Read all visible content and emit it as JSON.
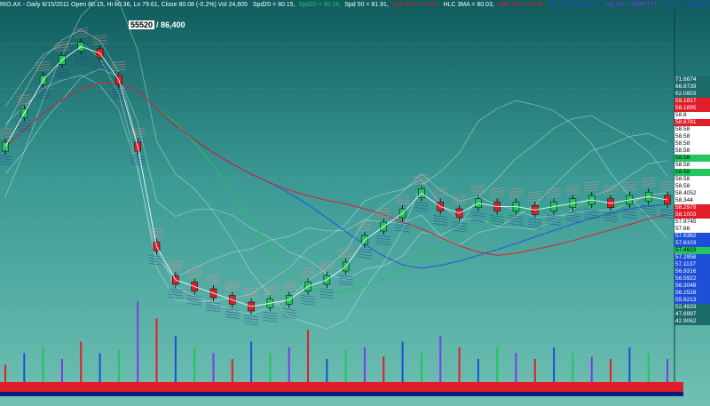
{
  "header": {
    "symbol": "RIO.AX - Daily 6/15/2011 Open 80.15, Hi 80.36, Lo 79.61, Close 80.08 (-0.2%) Vol 24,605",
    "indicators": [
      {
        "text": "Spd20 = 80.15,",
        "color": "#ffffff"
      },
      {
        "text": "Spd10 = 80.16,",
        "color": "#22c55e"
      },
      {
        "text": "Spd 50 = 81.91,",
        "color": "#ffffff"
      },
      {
        "text": "Spd 200 = 82.52,",
        "color": "#e11d2a"
      },
      {
        "text": "HLC 3MA = 80.03,",
        "color": "#ffffff"
      },
      {
        "text": "Spd 100 = 79.88,",
        "color": "#e11d2a"
      },
      {
        "text": "Dly R1 = {EMPTY},",
        "color": "#1d4ed8"
      },
      {
        "text": "Dly R2 = {EMPTY},",
        "color": "#7c3aed"
      },
      {
        "text": "Dly S1 = {EMPTY},",
        "color": "#1d4ed8"
      },
      {
        "text": "Daily Open = {EMPTY},",
        "color": "#111827"
      },
      {
        "text": "Daily Vol",
        "color": "#16a34a"
      }
    ]
  },
  "cursor": {
    "bar": "55520",
    "value": "/ 86,400"
  },
  "price_labels": [
    {
      "text": "71.6674",
      "bg": "#1b6b6a",
      "fg": "#ffffff"
    },
    {
      "text": "66.8739",
      "bg": "#1b6b6a",
      "fg": "#ffffff"
    },
    {
      "text": "62.0803",
      "bg": "#1b6b6a",
      "fg": "#ffffff"
    },
    {
      "text": "59.1817",
      "bg": "#e11d2a",
      "fg": "#ffffff"
    },
    {
      "text": "58.1895",
      "bg": "#e11d2a",
      "fg": "#ffffff"
    },
    {
      "text": "58.8",
      "bg": "#ffffff",
      "fg": "#000000"
    },
    {
      "text": "58.6781",
      "bg": "#e11d2a",
      "fg": "#ffffff"
    },
    {
      "text": "58.58",
      "bg": "#ffffff",
      "fg": "#000000"
    },
    {
      "text": "58.58",
      "bg": "#ffffff",
      "fg": "#000000"
    },
    {
      "text": "58.58",
      "bg": "#ffffff",
      "fg": "#000000"
    },
    {
      "text": "58.58",
      "bg": "#ffffff",
      "fg": "#000000"
    },
    {
      "text": "58.58",
      "bg": "#22c55e",
      "fg": "#000000"
    },
    {
      "text": "58.58",
      "bg": "#ffffff",
      "fg": "#000000"
    },
    {
      "text": "58.58",
      "bg": "#22c55e",
      "fg": "#000000"
    },
    {
      "text": "58.58",
      "bg": "#ffffff",
      "fg": "#000000"
    },
    {
      "text": "58.58",
      "bg": "#ffffff",
      "fg": "#000000"
    },
    {
      "text": "58.4052",
      "bg": "#ffffff",
      "fg": "#000000"
    },
    {
      "text": "58.344",
      "bg": "#ffffff",
      "fg": "#000000"
    },
    {
      "text": "58.2979",
      "bg": "#e11d2a",
      "fg": "#ffffff"
    },
    {
      "text": "58.1003",
      "bg": "#e11d2a",
      "fg": "#ffffff"
    },
    {
      "text": "57.9745",
      "bg": "#ffffff",
      "fg": "#000000"
    },
    {
      "text": "57.66",
      "bg": "#ffffff",
      "fg": "#000000"
    },
    {
      "text": "57.6362",
      "bg": "#1d4ed8",
      "fg": "#ffffff"
    },
    {
      "text": "57.6103",
      "bg": "#1d4ed8",
      "fg": "#ffffff"
    },
    {
      "text": "57.4623",
      "bg": "#22c55e",
      "fg": "#000000"
    },
    {
      "text": "57.2958",
      "bg": "#1d4ed8",
      "fg": "#ffffff"
    },
    {
      "text": "57.1137",
      "bg": "#1d4ed8",
      "fg": "#ffffff"
    },
    {
      "text": "56.9316",
      "bg": "#1d4ed8",
      "fg": "#ffffff"
    },
    {
      "text": "56.5922",
      "bg": "#1d4ed8",
      "fg": "#ffffff"
    },
    {
      "text": "56.3048",
      "bg": "#1d4ed8",
      "fg": "#ffffff"
    },
    {
      "text": "56.2528",
      "bg": "#1d4ed8",
      "fg": "#ffffff"
    },
    {
      "text": "55.6213",
      "bg": "#1d4ed8",
      "fg": "#ffffff"
    },
    {
      "text": "52.4933",
      "bg": "#1b6b6a",
      "fg": "#ffffff"
    },
    {
      "text": "47.6997",
      "bg": "#1b6b6a",
      "fg": "#ffffff"
    },
    {
      "text": "42.9062",
      "bg": "#1b6b6a",
      "fg": "#ffffff"
    }
  ],
  "chart_data": {
    "type": "line",
    "y": [
      60,
      65,
      70,
      73,
      75,
      74,
      70,
      60,
      45,
      40,
      39,
      38,
      37,
      36,
      36.5,
      37,
      39,
      40,
      42,
      46,
      48,
      50,
      53,
      51,
      50,
      51.5,
      51,
      51,
      50.5,
      51,
      51.5,
      52,
      51.5,
      52,
      52.5,
      52
    ],
    "volume": [
      0.15,
      0.25,
      0.3,
      0.2,
      0.35,
      0.25,
      0.28,
      0.7,
      0.55,
      0.4,
      0.3,
      0.25,
      0.2,
      0.35,
      0.25,
      0.3,
      0.45,
      0.2,
      0.28,
      0.3,
      0.22,
      0.35,
      0.25,
      0.4,
      0.3,
      0.2,
      0.3,
      0.25,
      0.2,
      0.3,
      0.25,
      0.22,
      0.2,
      0.3,
      0.25,
      0.2
    ]
  }
}
